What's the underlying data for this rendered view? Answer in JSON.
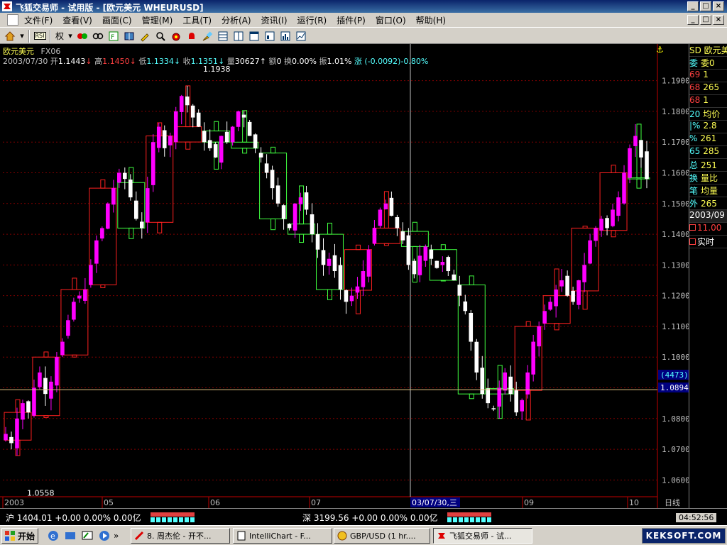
{
  "window": {
    "title": "飞狐交易师 - 试用版 - [欧元美元 WHEURUSD]",
    "min": "_",
    "max": "□",
    "close": "×"
  },
  "menu": [
    "文件(F)",
    "查看(V)",
    "画面(C)",
    "管理(M)",
    "工具(T)",
    "分析(A)",
    "资讯(I)",
    "运行(R)",
    "插件(P)",
    "窗口(O)",
    "帮助(H)"
  ],
  "toolbar": {
    "rsi_label": "RSI",
    "quan_label": "权"
  },
  "info": {
    "name": "欧元美元",
    "code": "FX06",
    "date": "2003/07/30",
    "open_label": "开",
    "open": "1.1443",
    "high_label": "高",
    "high": "1.1450",
    "low_label": "低",
    "low": "1.1334",
    "close_label": "收",
    "close": "1.1351",
    "vol_label": "量",
    "vol": "30627",
    "amt_label": "额",
    "amt": "0",
    "turn_label": "换",
    "turn": "0.00%",
    "amp_label": "振",
    "amp": "1.01%",
    "chg_label": "涨",
    "chg": "(-0.0092)",
    "chg_pct": "-0.80%"
  },
  "chart_data": {
    "type": "candlestick",
    "ylim": [
      1.055,
      1.195
    ],
    "y_ticks": [
      "1.1900",
      "1.1800",
      "1.1700",
      "1.1600",
      "1.1500",
      "1.1400",
      "1.1300",
      "1.1200",
      "1.1100",
      "1.1000",
      "1.0900",
      "1.0800",
      "1.0700",
      "1.0600"
    ],
    "x_labels": [
      "2003",
      "05",
      "06",
      "07",
      "09",
      "10"
    ],
    "x_end_label": "日线",
    "crosshair_date_label": "03/07/30,三",
    "crosshair_price_label": "1.0894",
    "crosshair_count_label": "(4473)",
    "max_label": "1.1938",
    "min_label": "1.0558",
    "closes": [
      1.075,
      1.072,
      1.08,
      1.085,
      1.082,
      1.09,
      1.095,
      1.088,
      1.092,
      1.1,
      1.105,
      1.112,
      1.118,
      1.12,
      1.122,
      1.13,
      1.138,
      1.142,
      1.15,
      1.155,
      1.16,
      1.158,
      1.152,
      1.145,
      1.142,
      1.155,
      1.17,
      1.175,
      1.168,
      1.172,
      1.18,
      1.185,
      1.182,
      1.178,
      1.175,
      1.17,
      1.168,
      1.165,
      1.172,
      1.17,
      1.175,
      1.18,
      1.178,
      1.172,
      1.168,
      1.165,
      1.16,
      1.155,
      1.15,
      1.145,
      1.142,
      1.15,
      1.152,
      1.148,
      1.14,
      1.135,
      1.13,
      1.132,
      1.128,
      1.122,
      1.118,
      1.12,
      1.123,
      1.128,
      1.135,
      1.142,
      1.148,
      1.15,
      1.146,
      1.142,
      1.138,
      1.13,
      1.127,
      1.133,
      1.136,
      1.132,
      1.129,
      1.131,
      1.128,
      1.125,
      1.12,
      1.115,
      1.105,
      1.095,
      1.088,
      1.085,
      1.083,
      1.09,
      1.095,
      1.088,
      1.082,
      1.086,
      1.095,
      1.105,
      1.11,
      1.115,
      1.118,
      1.122,
      1.125,
      1.12,
      1.118,
      1.125,
      1.13,
      1.138,
      1.142,
      1.145,
      1.142,
      1.148,
      1.152,
      1.16,
      1.168,
      1.172,
      1.165,
      1.158
    ],
    "last_bar": {
      "open": 1.1443,
      "high": 1.145,
      "low": 1.1334,
      "close": 1.1351
    }
  },
  "right_panel": {
    "header": "SD 欧元美",
    "rows": [
      [
        "委",
        "委0"
      ],
      [
        "69",
        "1"
      ],
      [
        "68",
        "265"
      ],
      [
        "68",
        "1"
      ],
      [
        "20",
        "均价"
      ],
      [
        "|%",
        "2.8"
      ],
      [
        "%",
        "261"
      ],
      [
        "65",
        "285"
      ],
      [
        "总",
        "251"
      ],
      [
        "换",
        "量比"
      ],
      [
        "笔",
        "均量"
      ],
      [
        "外",
        "265"
      ]
    ],
    "date": "2003/09",
    "time": "11.00",
    "realtime": "实时"
  },
  "status": {
    "sh_label": "沪",
    "sh_value": "1404.01",
    "sh_change": "+0.00",
    "sh_pct": "0.00%",
    "sh_amt": "0.00亿",
    "sz_label": "深",
    "sz_value": "3199.56",
    "sz_change": "+0.00",
    "sz_pct": "0.00%",
    "sz_amt": "0.00亿",
    "clock": "04:52:56"
  },
  "taskbar": {
    "start": "开始",
    "tasks": [
      "8. 周杰伦 - 开不...",
      "IntelliChart - F...",
      "GBP/USD (1 hr....",
      "飞狐交易师 - 试..."
    ],
    "tray": "KEKSOFT.COM"
  },
  "colors": {
    "up": "#ff00ff",
    "down": "#ffffff",
    "box_up": "#ff2020",
    "box_down": "#40ff40",
    "grid": "#800000",
    "crosshair": "#c0c0c0",
    "price_axis": "#c0c0c0"
  }
}
